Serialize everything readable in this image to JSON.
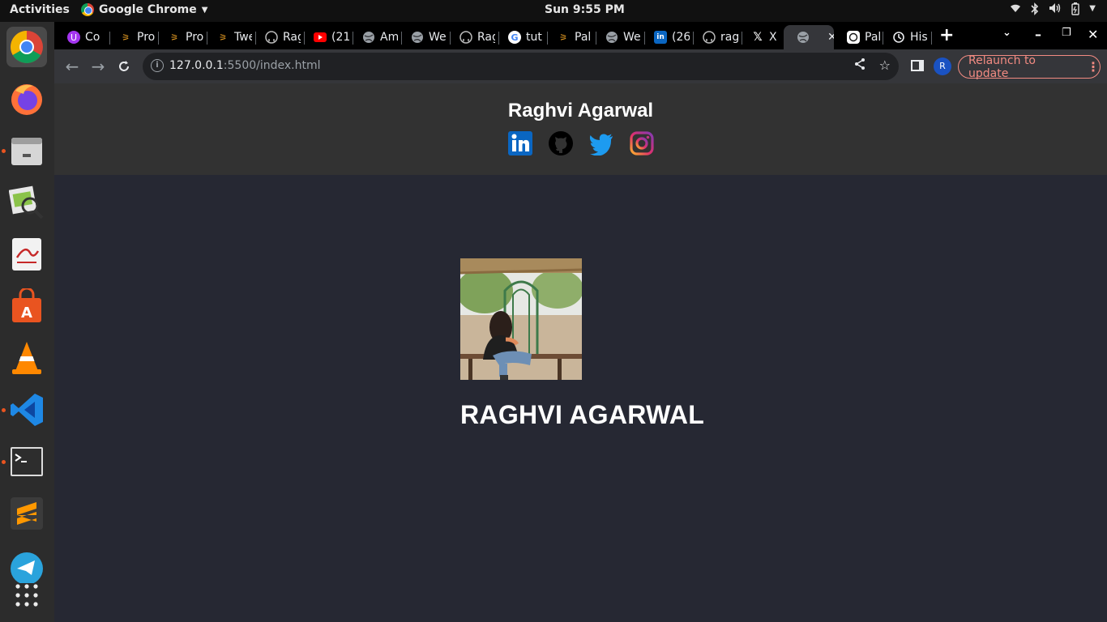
{
  "system": {
    "activities": "Activities",
    "app_name": "Google Chrome",
    "clock": "Sun  9:55 PM"
  },
  "browser": {
    "tabs": [
      {
        "label": "Co",
        "icon": "udemy-icon"
      },
      {
        "label": "Pro",
        "icon": "codeforces-icon"
      },
      {
        "label": "Pro",
        "icon": "codeforces-icon"
      },
      {
        "label": "Twe",
        "icon": "codeforces-icon"
      },
      {
        "label": "Rag",
        "icon": "github-icon"
      },
      {
        "label": "(21",
        "icon": "youtube-icon"
      },
      {
        "label": "Am",
        "icon": "globe-icon"
      },
      {
        "label": "We",
        "icon": "globe-icon"
      },
      {
        "label": "Rag",
        "icon": "github-icon"
      },
      {
        "label": "tut",
        "icon": "google-icon"
      },
      {
        "label": "Pal",
        "icon": "codeforces-icon"
      },
      {
        "label": "We",
        "icon": "globe-icon"
      },
      {
        "label": "(26",
        "icon": "linkedin-icon"
      },
      {
        "label": "rag",
        "icon": "github-icon"
      },
      {
        "label": "X",
        "icon": "x-icon"
      },
      {
        "label": "",
        "icon": "globe-icon"
      },
      {
        "label": "Pal",
        "icon": "chatgpt-icon"
      },
      {
        "label": "His",
        "icon": "history-icon"
      }
    ],
    "url_host": "127.0.0.1",
    "url_rest": ":5500/index.html",
    "profile_initial": "R",
    "relaunch_label": "Relaunch to update"
  },
  "page": {
    "site_name": "Raghvi Agarwal",
    "hero_name": "RAGHVI AGARWAL",
    "socials": [
      "linkedin-icon",
      "github-icon",
      "twitter-icon",
      "instagram-icon"
    ]
  },
  "colors": {
    "page_bg": "#262833",
    "header_bg": "#323232",
    "linkedin": "#0a66c2",
    "twitter": "#1d9bf0",
    "relaunch": "#f28b82"
  }
}
